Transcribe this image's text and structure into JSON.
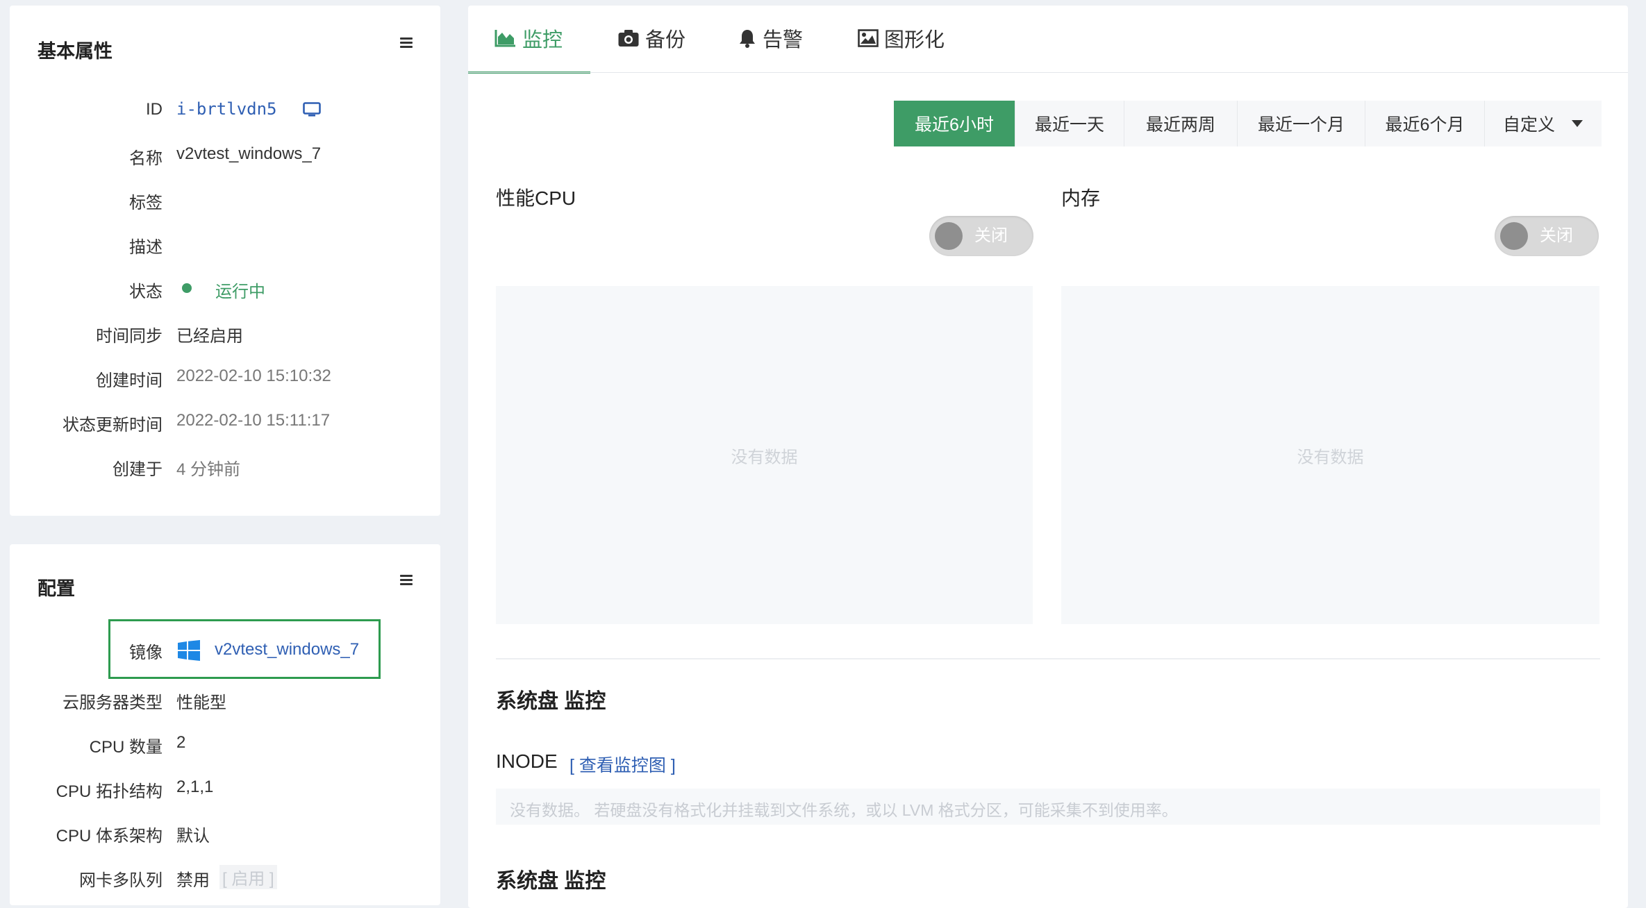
{
  "basic": {
    "title": "基本属性",
    "rows": [
      {
        "label": "ID",
        "value": "i-brtlvdn5"
      },
      {
        "label": "名称",
        "value": "v2vtest_windows_7"
      },
      {
        "label": "标签",
        "value": ""
      },
      {
        "label": "描述",
        "value": ""
      },
      {
        "label": "状态",
        "value": "运行中"
      },
      {
        "label": "时间同步",
        "value": "已经启用"
      },
      {
        "label": "创建时间",
        "value": "2022-02-10 15:10:32"
      },
      {
        "label": "状态更新时间",
        "value": "2022-02-10 15:11:17"
      },
      {
        "label": "创建于",
        "value": "4 分钟前"
      }
    ]
  },
  "config": {
    "title": "配置",
    "rows": [
      {
        "label": "镜像",
        "value": "v2vtest_windows_7"
      },
      {
        "label": "云服务器类型",
        "value": "性能型"
      },
      {
        "label": "CPU 数量",
        "value": "2"
      },
      {
        "label": "CPU 拓扑结构",
        "value": "2,1,1"
      },
      {
        "label": "CPU 体系架构",
        "value": "默认"
      },
      {
        "label": "网卡多队列",
        "value": "禁用",
        "extra": "[ 启用 ]"
      }
    ]
  },
  "tabs": [
    {
      "label": "监控",
      "icon": "area-chart-icon",
      "active": true
    },
    {
      "label": "备份",
      "icon": "camera-icon"
    },
    {
      "label": "告警",
      "icon": "bell-icon"
    },
    {
      "label": "图形化",
      "icon": "image-icon"
    }
  ],
  "ranges": [
    {
      "label": "最近6小时",
      "active": true
    },
    {
      "label": "最近一天"
    },
    {
      "label": "最近两周"
    },
    {
      "label": "最近一个月"
    },
    {
      "label": "最近6个月"
    },
    {
      "label": "自定义"
    }
  ],
  "charts": [
    {
      "title": "性能CPU",
      "toggle": "关闭",
      "empty": "没有数据"
    },
    {
      "title": "内存",
      "toggle": "关闭",
      "empty": "没有数据"
    }
  ],
  "disk": {
    "title": "系统盘 监控",
    "inode_label": "INODE",
    "inode_link": "[ 查看监控图 ]",
    "empty_note": "没有数据。 若硬盘没有格式化并挂载到文件系统，或以 LVM 格式分区，可能采集不到使用率。",
    "title2": "系统盘 监控"
  },
  "colors": {
    "accent": "#3e9c66",
    "link": "#2f5fb3",
    "status_running": "#3e9c66",
    "highlight_border": "#2e9b4f"
  }
}
